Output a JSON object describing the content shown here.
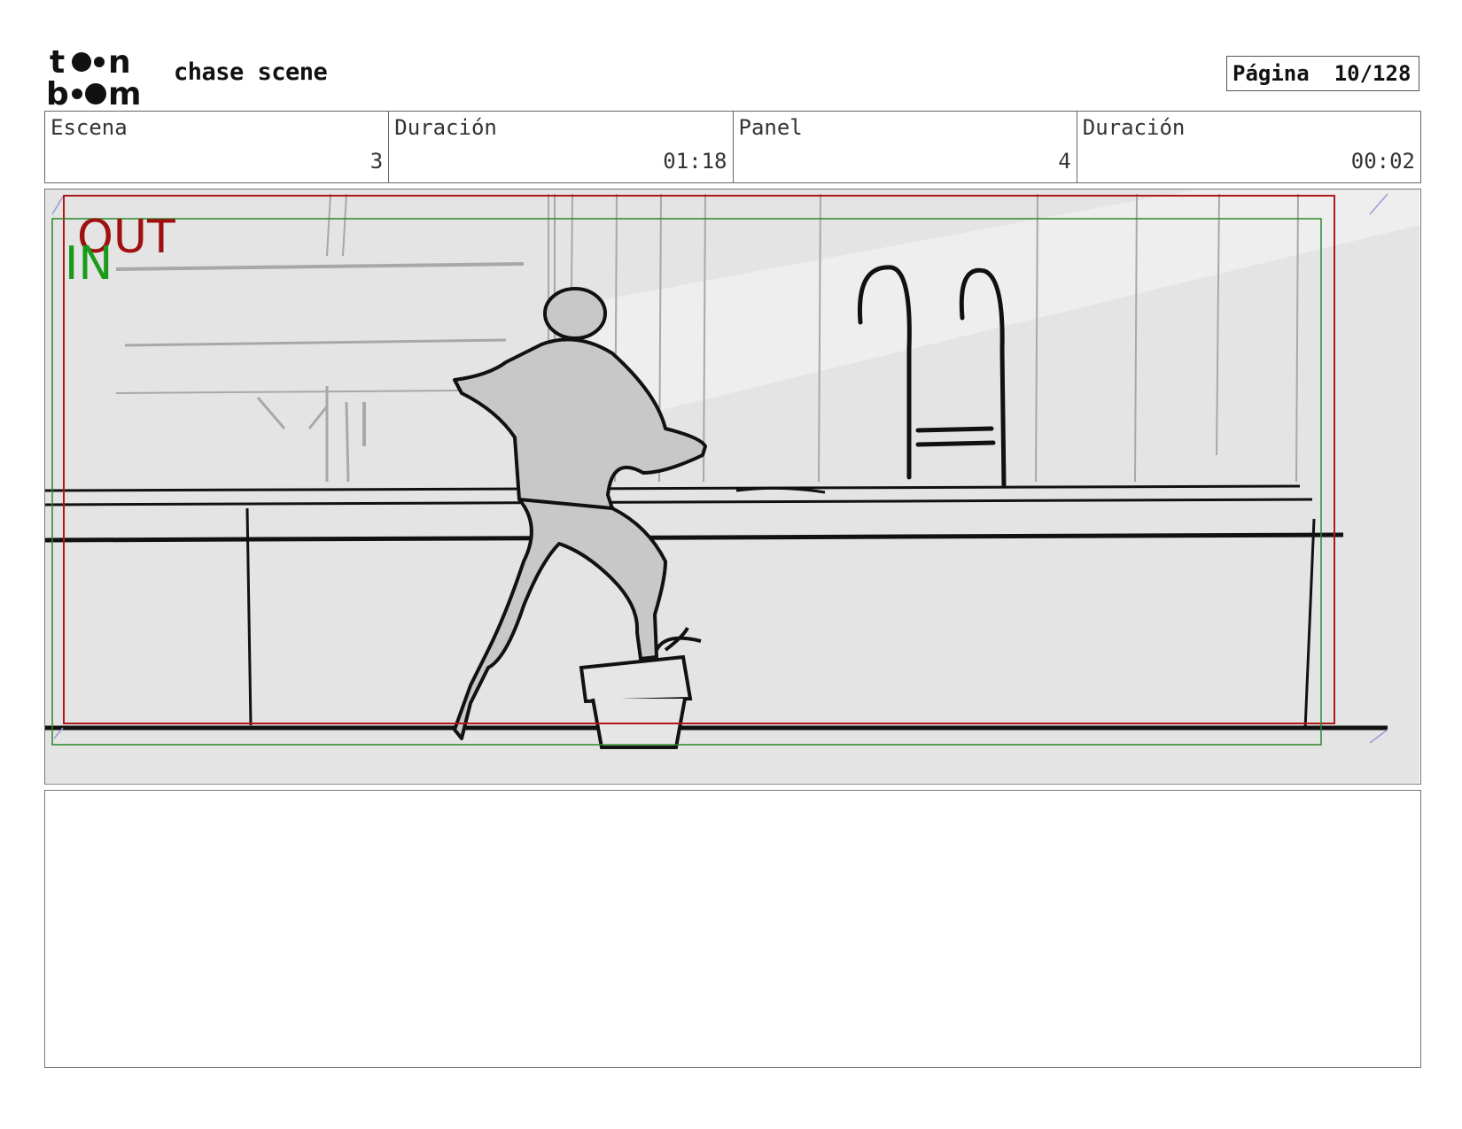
{
  "header": {
    "logo_text": "toon boom",
    "project_title": "chase scene",
    "page_label": "Página",
    "page_number": "10/128"
  },
  "info": [
    {
      "label": "Escena",
      "value": "3"
    },
    {
      "label": "Duración",
      "value": "01:18"
    },
    {
      "label": "Panel",
      "value": "4"
    },
    {
      "label": "Duración",
      "value": "00:02"
    }
  ],
  "panel": {
    "safe_out_label": "OUT",
    "safe_in_label": "IN",
    "colors": {
      "out_frame": "#b01818",
      "in_frame": "#2a8a2a"
    }
  },
  "notes": {
    "text": ""
  }
}
